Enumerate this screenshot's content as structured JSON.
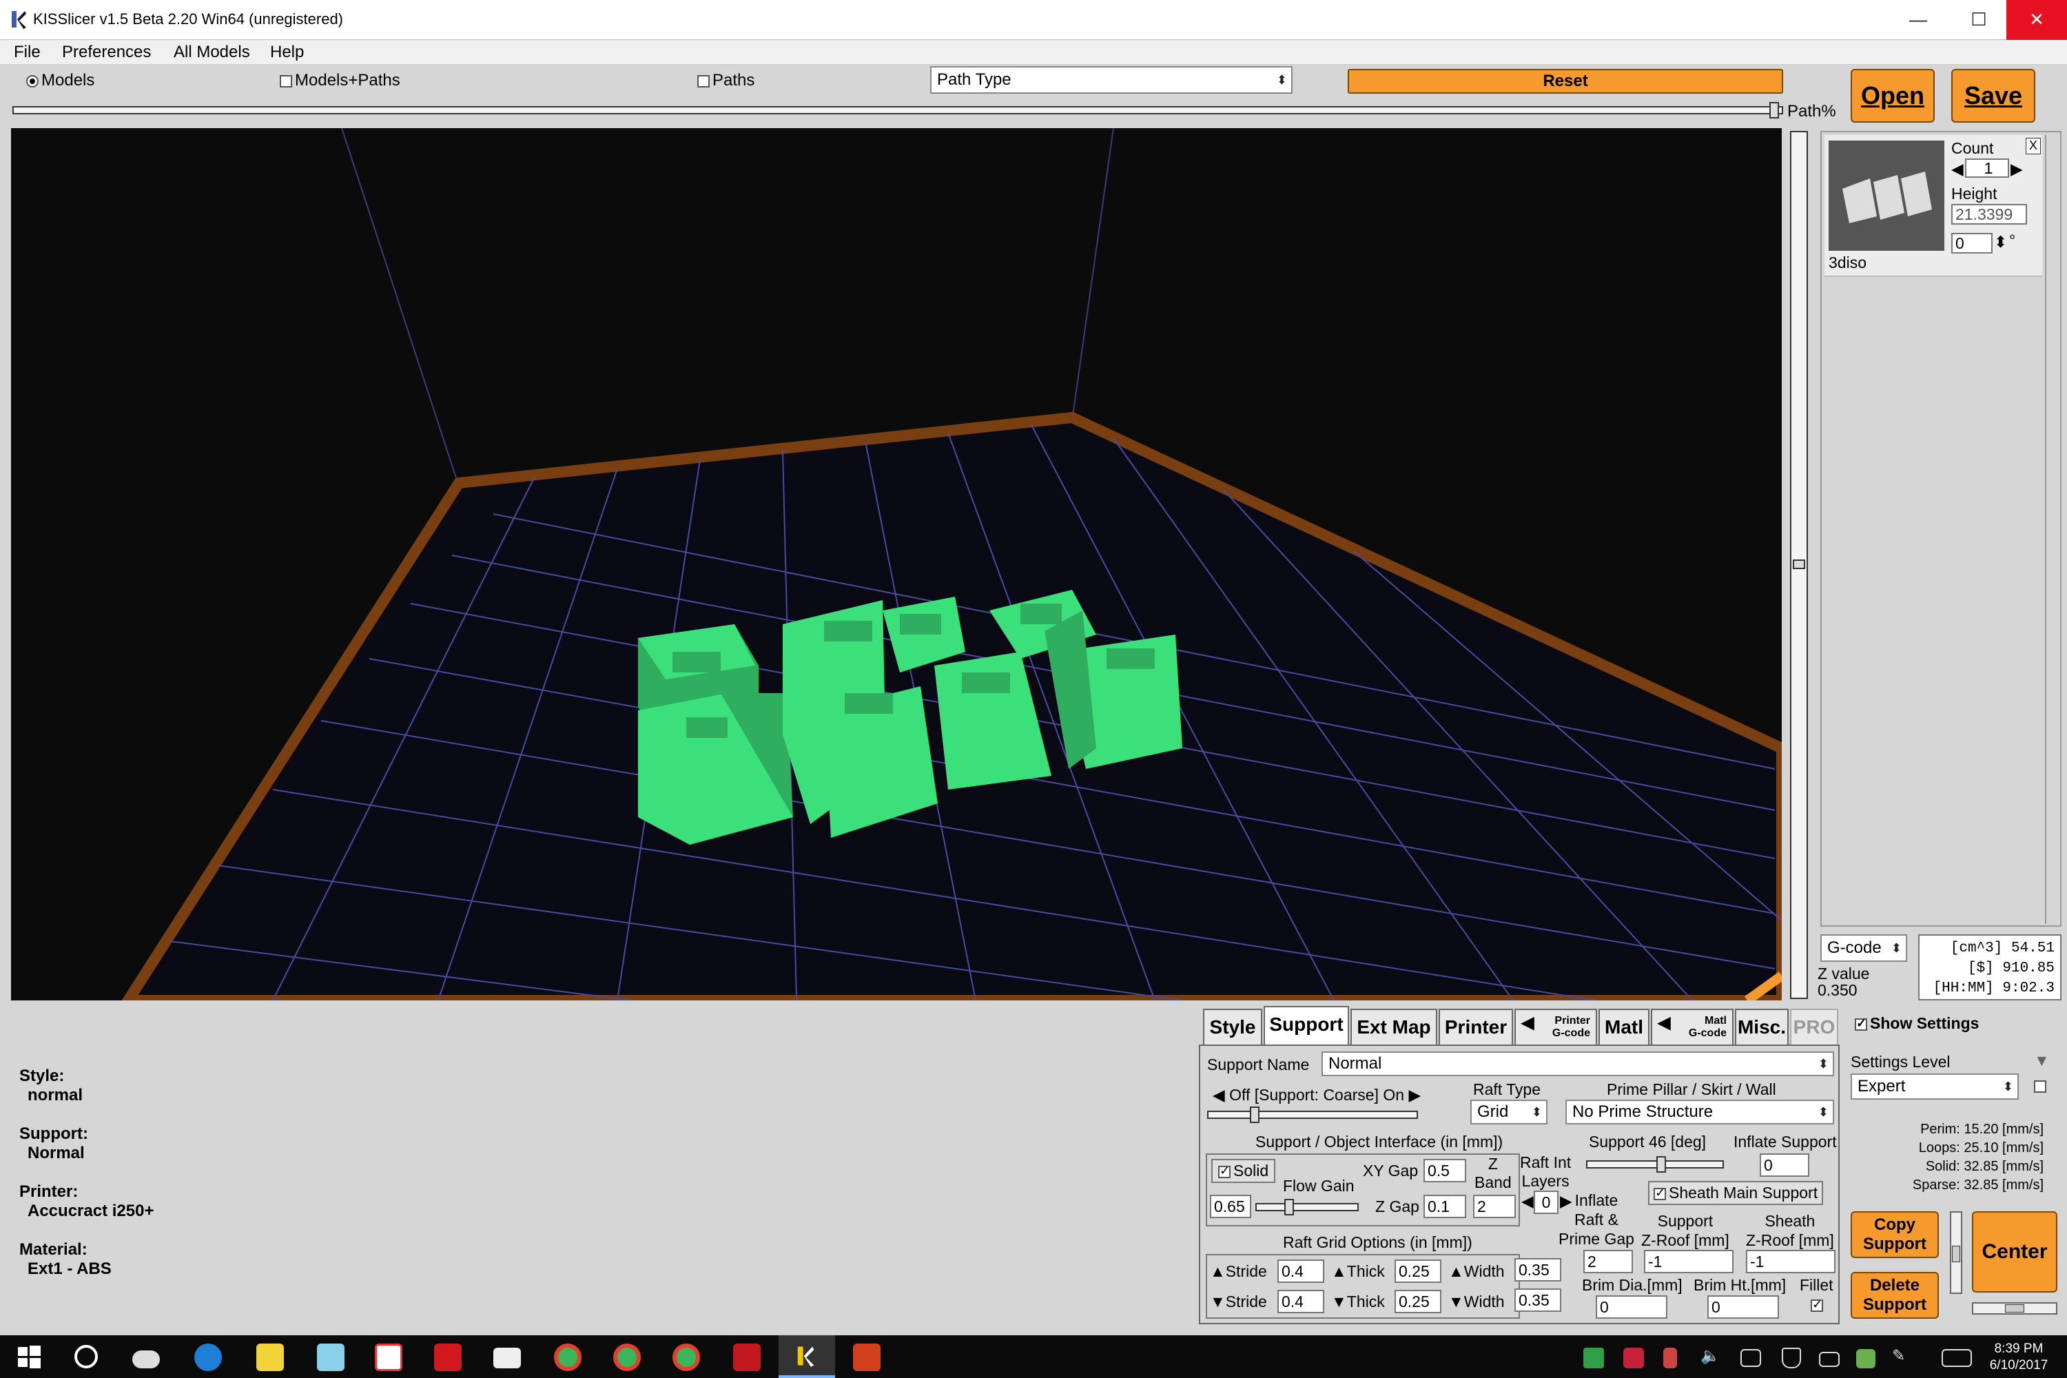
{
  "window": {
    "title": "KISSlicer v1.5 Beta 2.20 Win64 (unregistered)",
    "minimize": "—",
    "maximize": "☐",
    "close": "✕"
  },
  "menu": {
    "items": [
      "File",
      "Preferences",
      "All Models",
      "Help"
    ]
  },
  "toolbar": {
    "view_models": "Models",
    "view_models_paths": "Models+Paths",
    "view_paths": "Paths",
    "path_type": "Path Type",
    "reset": "Reset",
    "open": "Open",
    "save": "Save",
    "path_pct": "Path%"
  },
  "model_panel": {
    "count_label": "Count",
    "count": "1",
    "height_label": "Height",
    "height": "21.3399",
    "rotation": "0",
    "degree": "°",
    "close": "X",
    "model_name": "3diso"
  },
  "gcode": {
    "select": "G-code",
    "z_label": "Z value",
    "z_value": "0.350",
    "volume": "[cm^3]  54.51",
    "cost": "[$]  910.85",
    "time": "[HH:MM]  9:02.3"
  },
  "summary": {
    "style_label": "Style:",
    "style": "normal",
    "support_label": "Support:",
    "support": "Normal",
    "printer_label": "Printer:",
    "printer": "Accucract i250+",
    "material_label": "Material:",
    "material": "Ext1 - ABS"
  },
  "tabs": {
    "style": "Style",
    "support": "Support",
    "extmap": "Ext Map",
    "printer": "Printer",
    "printer_gcode_top": "Printer",
    "printer_gcode_bot": "G-code",
    "matl": "Matl",
    "matl_gcode_top": "Matl",
    "matl_gcode_bot": "G-code",
    "misc": "Misc.",
    "pro": "PRO"
  },
  "support": {
    "name_label": "Support Name",
    "name": "Normal",
    "slider_label": "Off [Support: Coarse] On",
    "raft_type_label": "Raft Type",
    "raft_type": "Grid",
    "prime_label": "Prime Pillar / Skirt /  Wall",
    "prime": "No Prime Structure",
    "interface_label": "Support / Object Interface (in [mm])",
    "solid": "Solid",
    "flow_gain": "Flow Gain",
    "flow_gain_val": "0.65",
    "xy_gap_label": "XY Gap",
    "xy_gap": "0.5",
    "z_gap_label": "Z Gap",
    "z_gap": "0.1",
    "z_band_l1": "Z",
    "z_band_l2": "Band",
    "z_band": "2",
    "raft_int_l1": "Raft Int",
    "raft_int_l2": "Layers",
    "raft_int": "0",
    "angle_label": "Support 46 [deg]",
    "inflate_support_label": "Inflate Support",
    "inflate_support": "0",
    "sheath": "Sheath Main Support",
    "inflate_raft_l1": "Inflate",
    "inflate_raft_l2": "Raft &",
    "inflate_raft_l3": "Prime Gap",
    "inflate_raft": "2",
    "support_roof_l1": "Support",
    "support_roof_l2": "Z-Roof [mm]",
    "support_roof": "-1",
    "sheath_roof_l1": "Sheath",
    "sheath_roof_l2": "Z-Roof [mm]",
    "sheath_roof": "-1",
    "raft_grid_label": "Raft Grid Options (in [mm])",
    "stride": "Stride",
    "thick": "Thick",
    "width": "Width",
    "stride1": "0.4",
    "thick1": "0.25",
    "width1": "0.35",
    "stride2": "0.4",
    "thick2": "0.25",
    "width2": "0.35",
    "brim_dia_label": "Brim Dia.[mm]",
    "brim_dia": "0",
    "brim_ht_label": "Brim Ht.[mm]",
    "brim_ht": "0",
    "fillet_label": "Fillet"
  },
  "settings": {
    "show": "Show Settings",
    "level_label": "Settings Level",
    "level": "Expert",
    "perim": "Perim:  15.20 [mm/s]",
    "loops": "Loops:  25.10 [mm/s]",
    "solid": "Solid:  32.85 [mm/s]",
    "sparse": "Sparse: 32.85 [mm/s]",
    "copy_support": "Copy Support",
    "delete_support": "Delete Support",
    "center": "Center"
  },
  "taskbar": {
    "time": "8:39 PM",
    "date": "6/10/2017"
  },
  "colors": {
    "accent": "#f79a2e",
    "model": "#3be07a",
    "viewport": "#0b0b0b",
    "grid": "#4a4aa0",
    "bed_edge": "#7a3f10"
  }
}
